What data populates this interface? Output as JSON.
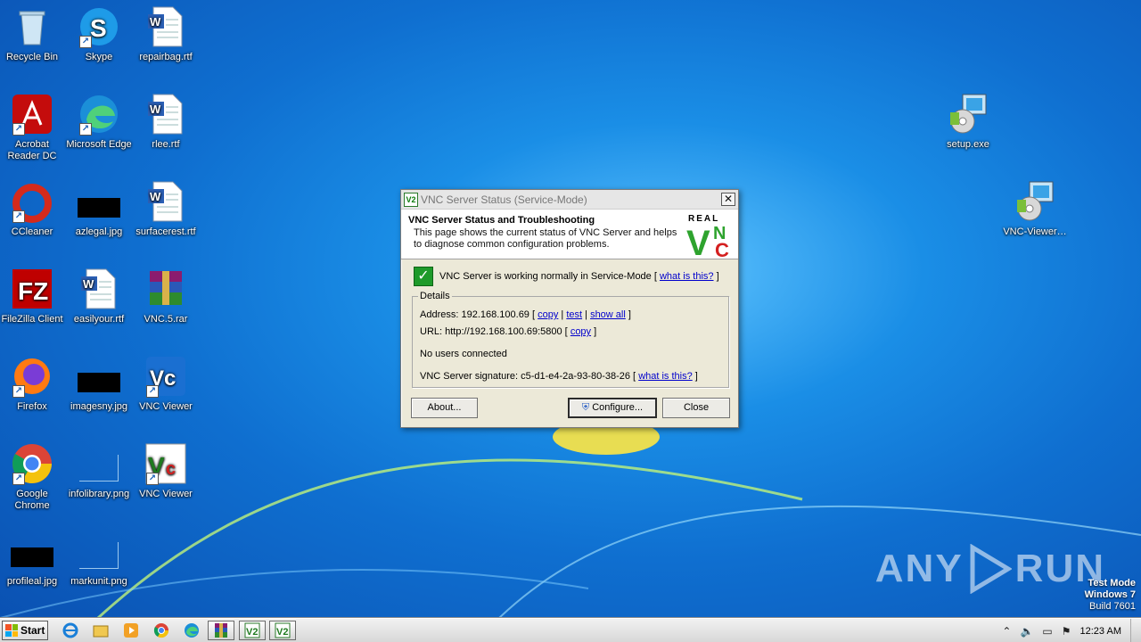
{
  "desktop": {
    "icons": [
      {
        "label": "Recycle Bin",
        "icon": "recycle-bin-icon"
      },
      {
        "label": "Skype",
        "icon": "skype-icon"
      },
      {
        "label": "repairbag.rtf",
        "icon": "word-document-icon"
      },
      {
        "label": "Acrobat Reader DC",
        "icon": "acrobat-icon"
      },
      {
        "label": "Microsoft Edge",
        "icon": "edge-icon"
      },
      {
        "label": "rlee.rtf",
        "icon": "word-document-icon"
      },
      {
        "label": "CCleaner",
        "icon": "ccleaner-icon"
      },
      {
        "label": "azlegal.jpg",
        "icon": "image-thumbnail-icon"
      },
      {
        "label": "surfacerest.rtf",
        "icon": "word-document-icon"
      },
      {
        "label": "FileZilla Client",
        "icon": "filezilla-icon"
      },
      {
        "label": "easilyour.rtf",
        "icon": "word-document-icon"
      },
      {
        "label": "VNC.5.rar",
        "icon": "winrar-icon"
      },
      {
        "label": "Firefox",
        "icon": "firefox-icon"
      },
      {
        "label": "imagesny.jpg",
        "icon": "image-thumbnail-icon"
      },
      {
        "label": "VNC Viewer",
        "icon": "vnc-viewer-icon"
      },
      {
        "label": "Google Chrome",
        "icon": "chrome-icon"
      },
      {
        "label": "infolibrary.png",
        "icon": "image-thumbnail-icon"
      },
      {
        "label": "VNC Viewer",
        "icon": "vnc-viewer-icon"
      },
      {
        "label": "profileal.jpg",
        "icon": "image-thumbnail-icon"
      },
      {
        "label": "markunit.png",
        "icon": "image-thumbnail-icon"
      },
      {
        "label": "setup.exe",
        "icon": "installer-icon"
      },
      {
        "label": "VNC-Viewer…",
        "icon": "installer-icon"
      }
    ]
  },
  "dialog": {
    "title": "VNC Server Status (Service-Mode)",
    "header_title": "VNC Server Status and Troubleshooting",
    "header_desc": "This page shows the current status of VNC Server and helps to diagnose common configuration problems.",
    "logo_top": "REAL",
    "logo_v": "V",
    "logo_n": "N",
    "logo_c": "C",
    "status_text": "VNC Server is working normally in Service-Mode [",
    "status_link": "what is this?",
    "status_end": "]",
    "details_legend": "Details",
    "address_label": "Address: 192.168.100.69 [",
    "copy": "copy",
    "test": "test",
    "show_all": "show all",
    "url_label": "URL: http://192.168.100.69:5800 [",
    "no_users": "No users connected",
    "signature_label": "VNC Server signature: c5-d1-e4-2a-93-80-38-26 [",
    "sig_link": "what is this?",
    "about_button": "About...",
    "configure_button": "Configure...",
    "close_button": "Close"
  },
  "watermark": {
    "text_any": "ANY",
    "text_run": "RUN"
  },
  "testmode": {
    "line1": "Test Mode",
    "line2": "Windows 7",
    "line3": "Build 7601"
  },
  "taskbar": {
    "start_label": "Start",
    "clock": "12:23 AM"
  },
  "colors": {
    "desktop_blue": "#1a8ee6",
    "dialog_bg": "#ece9d8",
    "link": "#0000cc",
    "check_green": "#1e9a2a"
  }
}
